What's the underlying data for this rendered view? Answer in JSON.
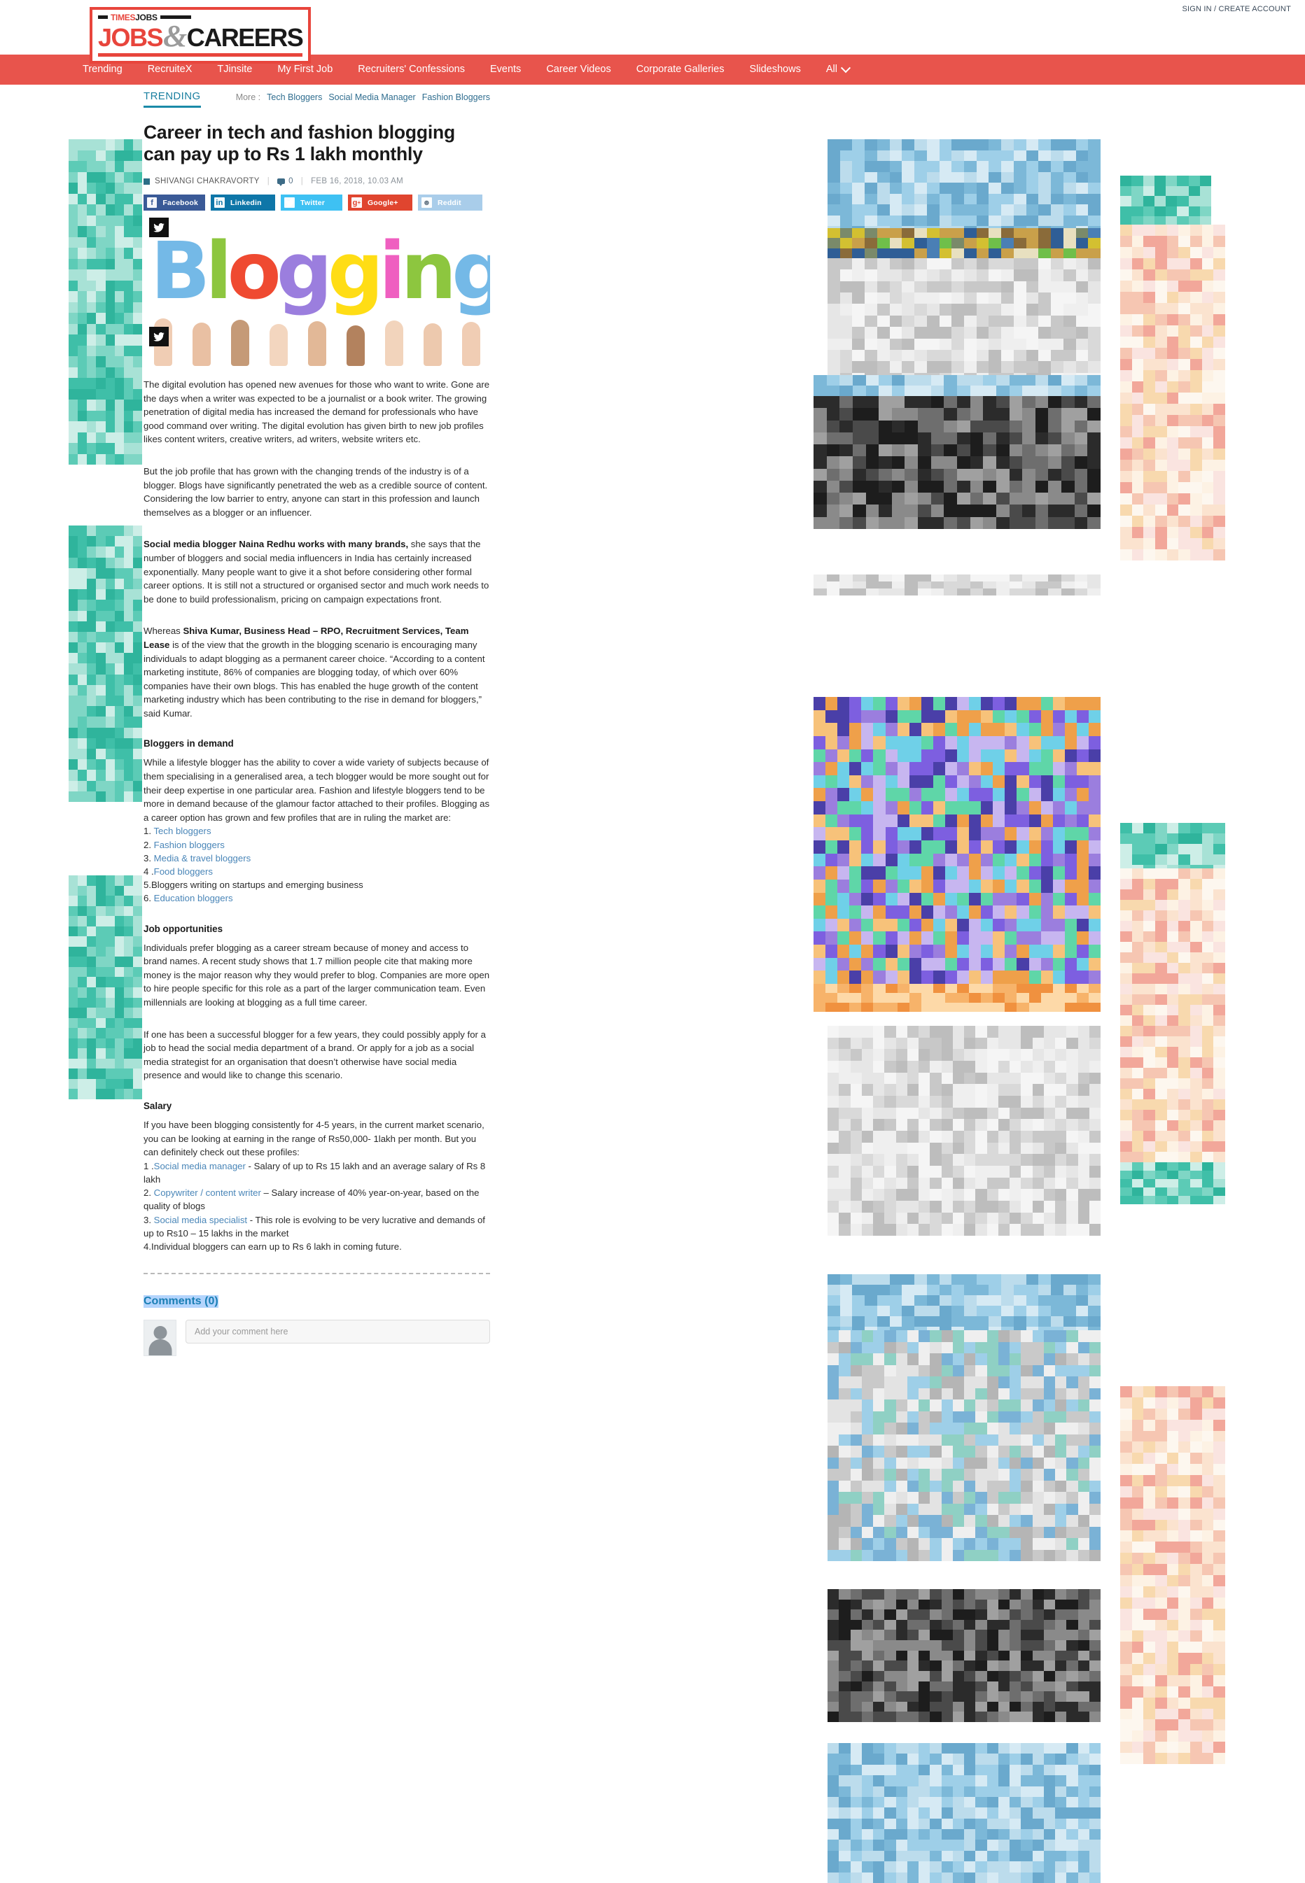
{
  "site": {
    "logo": {
      "kicker_times": "TIMES",
      "kicker_jobs": "JOBS",
      "jobs": "JOBS",
      "amp": "&",
      "careers": "CAREERS"
    },
    "signin": "SIGN IN / CREATE ACCOUNT"
  },
  "nav": {
    "items": [
      {
        "label": "Trending"
      },
      {
        "label": "RecruiteX"
      },
      {
        "label": "TJinsite"
      },
      {
        "label": "My First Job"
      },
      {
        "label": "Recruiters' Confessions"
      },
      {
        "label": "Events"
      },
      {
        "label": "Career Videos"
      },
      {
        "label": "Corporate Galleries"
      },
      {
        "label": "Slideshows"
      },
      {
        "label": "All"
      }
    ]
  },
  "article": {
    "section_label": "TRENDING",
    "more_label": "More :",
    "more_links": [
      "Tech Bloggers",
      "Social Media Manager",
      "Fashion Bloggers"
    ],
    "headline": "Career in tech and fashion blogging can pay up to Rs 1 lakh monthly",
    "author": "SHIVANGI CHAKRAVORTY",
    "comment_count": "0",
    "date": "FEB 16, 2018, 10.03 AM",
    "share": [
      {
        "name": "Facebook",
        "label": "Facebook",
        "icon": "f",
        "color": "#3a5a97"
      },
      {
        "name": "Linkedin",
        "label": "Linkedin",
        "icon": "in",
        "color": "#0e76a8"
      },
      {
        "name": "Twitter",
        "label": "Twitter",
        "icon": "ᵗ",
        "color": "#3ec1f3"
      },
      {
        "name": "Google+",
        "label": "Google+",
        "icon": "g+",
        "color": "#e0452f"
      },
      {
        "name": "Reddit",
        "label": "Reddit",
        "icon": "ⓡ",
        "color": "#a9cdea"
      }
    ],
    "hero": {
      "word": "Blogging",
      "letters": [
        {
          "ch": "B",
          "color": "#74b9e7"
        },
        {
          "ch": "l",
          "color": "#8dc63f"
        },
        {
          "ch": "o",
          "color": "#ef4a31"
        },
        {
          "ch": "g",
          "color": "#9b7ede"
        },
        {
          "ch": "g",
          "color": "#ffdd15"
        },
        {
          "ch": "i",
          "color": "#ef5fc0"
        },
        {
          "ch": "n",
          "color": "#8dc63f"
        },
        {
          "ch": "g",
          "color": "#74b9e7"
        }
      ]
    },
    "paragraphs": {
      "p1": "The digital evolution has opened new avenues for those who want to write. Gone are the days when a writer was expected to be a journalist or a book writer. The growing penetration of digital media has increased the demand for professionals who have good command over writing. The digital evolution has given birth to new job profiles likes content writers, creative writers, ad writers, website writers etc.",
      "p2": "But the job profile that has grown with the changing trends of the industry is of a blogger. Blogs have significantly penetrated the web as a credible source of content. Considering the low barrier to entry, anyone can start in this profession and launch themselves as a blogger or an influencer.",
      "p3_bold": "Social media blogger Naina Redhu works with many brands,",
      "p3_rest": " she says that the number of bloggers and social media influencers in India has certainly increased exponentially. Many people want to give it a shot before considering other formal career options. It is still not a structured or organised sector and much work needs to be done to build professionalism, pricing on campaign expectations front.",
      "p4_pre": "Whereas ",
      "p4_bold": "Shiva Kumar, Business Head – RPO, Recruitment Services, Team Lease",
      "p4_rest": " is of the view that the growth in the blogging scenario is encouraging many individuals to adapt blogging as a permanent career choice. “According to a content marketing institute, 86% of companies are blogging today, of which over 60% companies have their own blogs. This has enabled the huge growth of the content marketing industry which has been contributing to the rise in demand for bloggers,” said Kumar."
    },
    "section_demand": {
      "heading": "Bloggers in demand",
      "intro": "While a lifestyle blogger has the ability to cover a wide variety of subjects because of them specialising in a generalised area, a tech blogger would be more sought out for their deep expertise in one particular area. Fashion and lifestyle bloggers tend to be more in demand because of the glamour factor attached to their profiles. Blogging as a career option has grown and few profiles that are in ruling the market are:",
      "items": [
        {
          "num": "1. ",
          "link": "Tech bloggers",
          "rest": ""
        },
        {
          "num": "2. ",
          "link": "Fashion bloggers",
          "rest": ""
        },
        {
          "num": "3. ",
          "link": "Media & travel bloggers",
          "rest": ""
        },
        {
          "num": "4 .",
          "link": "Food bloggers",
          "rest": ""
        },
        {
          "num": "5.",
          "link": "",
          "rest": "Bloggers writing on startups and emerging business"
        },
        {
          "num": "6. ",
          "link": "Education bloggers",
          "rest": ""
        }
      ]
    },
    "section_jobs": {
      "heading": "Job opportunities",
      "p1": "Individuals prefer blogging as a career stream because of money and access to brand names. A recent study shows that 1.7 million people cite that making more money is the major reason why they would prefer to blog. Companies are more open to hire people specific for this role as a part of the larger communication team. Even millennials are looking at blogging as a full time career.",
      "p2": "If one has been a successful blogger for a few years, they could possibly apply for a job to head the social media department of a brand. Or apply for a job as a social media strategist for an organisation that doesn’t otherwise have social media presence and would like to change this scenario."
    },
    "section_salary": {
      "heading": "Salary",
      "intro": "If you have been blogging consistently for 4-5 years, in the current market scenario, you can be looking at earning in the range of Rs50,000- 1lakh per month. But you can definitely check out these profiles:",
      "items": [
        {
          "num": "1 .",
          "link": "Social media manager",
          "rest": " - Salary of up to Rs 15 lakh and an average salary of Rs 8 lakh"
        },
        {
          "num": "2. ",
          "link": "Copywriter / content writer",
          "rest": " – Salary increase of 40% year-on-year, based on the quality of blogs"
        },
        {
          "num": "3. ",
          "link": "Social media specialist",
          "rest": " - This role is evolving to be very lucrative and demands of up to Rs10 – 15 lakhs in the market"
        },
        {
          "num": "4.",
          "link": "",
          "rest": "Individual bloggers can earn up to Rs 6 lakh in coming future."
        }
      ]
    },
    "comments": {
      "heading": "Comments (0)",
      "input_placeholder": "Add your comment here"
    }
  }
}
